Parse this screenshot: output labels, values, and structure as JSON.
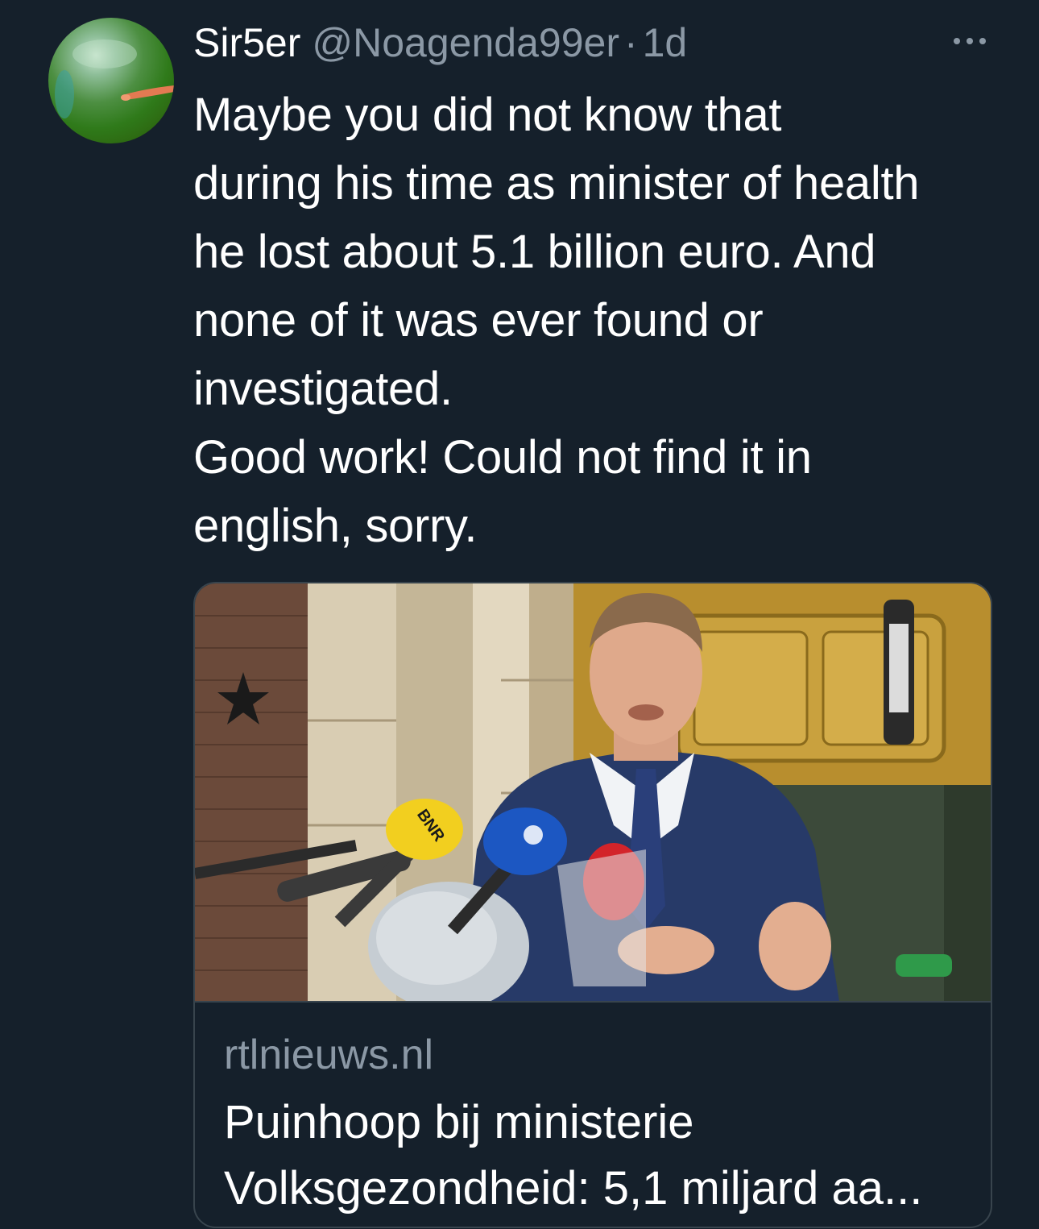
{
  "tweet": {
    "display_name": "Sir5er",
    "handle": "@Noagenda99er",
    "separator": "·",
    "time": "1d",
    "text": "Maybe you did not know that\nduring his time as minister of health\nhe lost about 5.1 billion euro. And\nnone of it was ever found or\ninvestigated.\nGood work! Could not find it in\nenglish, sorry."
  },
  "card": {
    "domain": "rtlnieuws.nl",
    "title": "Puinhoop bij ministerie\nVolksgezondheid: 5,1 miljard aa...",
    "image_subject": "man in suit speaking at press microphones",
    "mic_label": "BNR"
  },
  "icons": {
    "more": "more-horizontal-icon"
  },
  "colors": {
    "background": "#15202b",
    "text_primary": "#ffffff",
    "text_secondary": "#8b98a5",
    "border": "#38444d"
  }
}
